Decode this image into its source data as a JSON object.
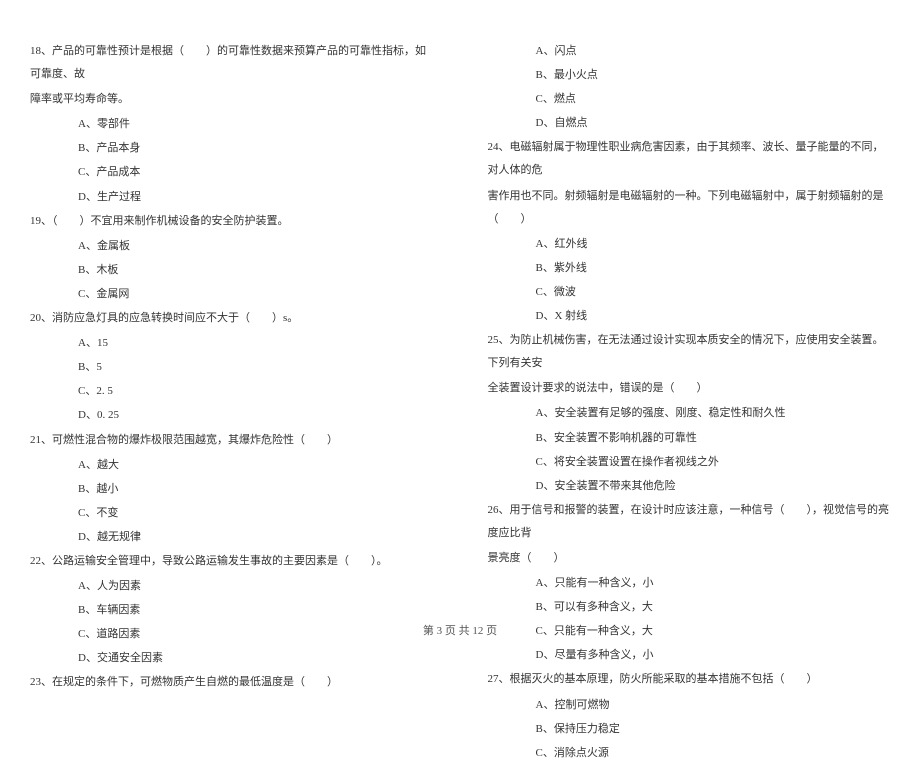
{
  "left_col": {
    "q18": {
      "stem": "18、产品的可靠性预计是根据（　　）的可靠性数据来预算产品的可靠性指标，如可靠度、故",
      "stem2": "障率或平均寿命等。",
      "opts": [
        "A、零部件",
        "B、产品本身",
        "C、产品成本",
        "D、生产过程"
      ]
    },
    "q19": {
      "stem": "19、（　　）不宜用来制作机械设备的安全防护装置。",
      "opts": [
        "A、金属板",
        "B、木板",
        "C、金属网"
      ]
    },
    "q20": {
      "stem": "20、消防应急灯具的应急转换时间应不大于（　　）s。",
      "opts": [
        "A、15",
        "B、5",
        "C、2. 5",
        "D、0. 25"
      ]
    },
    "q21": {
      "stem": "21、可燃性混合物的爆炸极限范围越宽，其爆炸危险性（　　）",
      "opts": [
        "A、越大",
        "B、越小",
        "C、不变",
        "D、越无规律"
      ]
    },
    "q22": {
      "stem": "22、公路运输安全管理中，导致公路运输发生事故的主要因素是（　　）。",
      "opts": [
        "A、人为因素",
        "B、车辆因素",
        "C、道路因素",
        "D、交通安全因素"
      ]
    },
    "q23": {
      "stem": "23、在规定的条件下，可燃物质产生自燃的最低温度是（　　）"
    }
  },
  "right_col": {
    "q23_opts": [
      "A、闪点",
      "B、最小火点",
      "C、燃点",
      "D、自燃点"
    ],
    "q24": {
      "stem": "24、电磁辐射属于物理性职业病危害因素，由于其频率、波长、量子能量的不同，对人体的危",
      "stem2": "害作用也不同。射频辐射是电磁辐射的一种。下列电磁辐射中，属于射频辐射的是（　　）",
      "opts": [
        "A、红外线",
        "B、紫外线",
        "C、微波",
        "D、X 射线"
      ]
    },
    "q25": {
      "stem": "25、为防止机械伤害，在无法通过设计实现本质安全的情况下，应使用安全装置。下列有关安",
      "stem2": "全装置设计要求的说法中，错误的是（　　）",
      "opts": [
        "A、安全装置有足够的强度、刚度、稳定性和耐久性",
        "B、安全装置不影响机器的可靠性",
        "C、将安全装置设置在操作者视线之外",
        "D、安全装置不带来其他危险"
      ]
    },
    "q26": {
      "stem": "26、用于信号和报警的装置，在设计时应该注意，一种信号（　　），视觉信号的亮度应比背",
      "stem2": "景亮度（　　）",
      "opts": [
        "A、只能有一种含义，小",
        "B、可以有多种含义，大",
        "C、只能有一种含义，大",
        "D、尽量有多种含义，小"
      ]
    },
    "q27": {
      "stem": "27、根据灭火的基本原理，防火所能采取的基本措施不包括（　　）",
      "opts": [
        "A、控制可燃物",
        "B、保持压力稳定",
        "C、消除点火源"
      ]
    }
  },
  "footer": "第 3 页 共 12 页"
}
